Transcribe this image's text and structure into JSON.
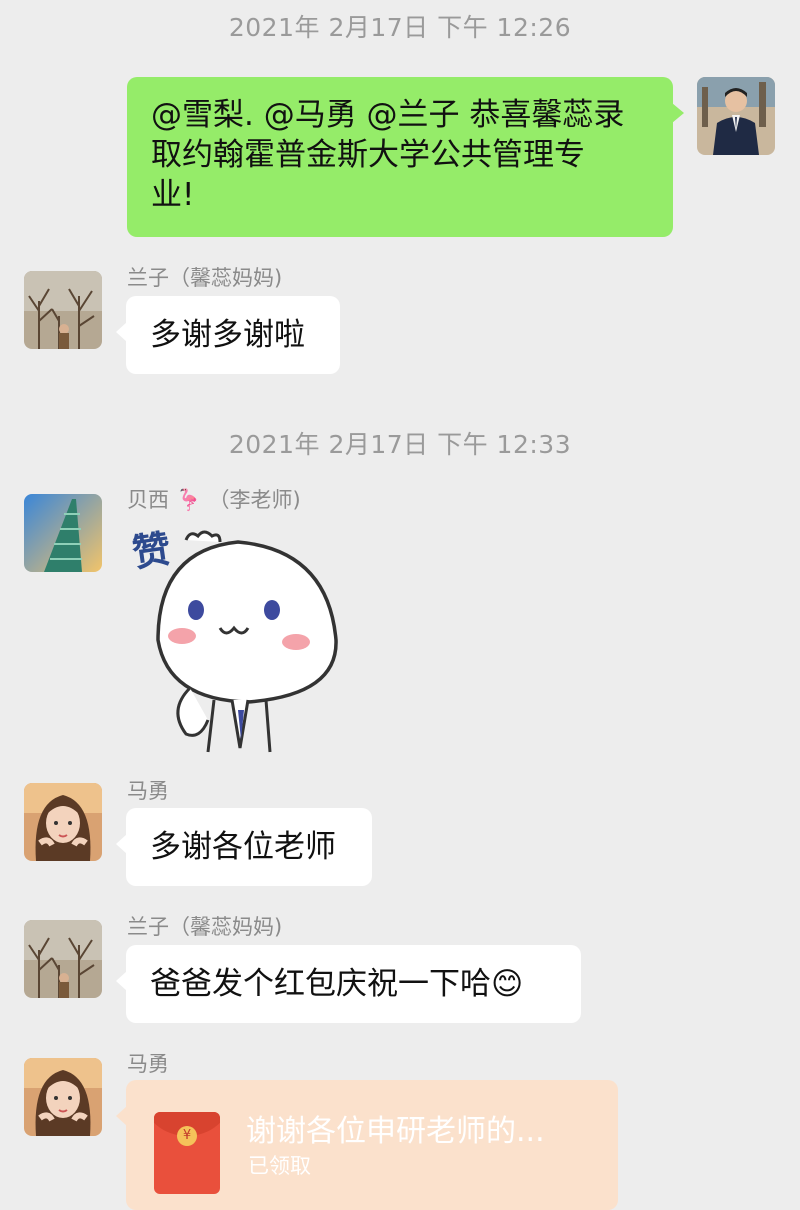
{
  "messages": [
    {
      "type": "timestamp",
      "text": "2021年 2月17日 下午 12:26"
    },
    {
      "type": "outgoing",
      "sender": "self",
      "text_line1": "@雪梨. @马勇 @兰子 恭喜馨蕊录",
      "text_line2": "取约翰霍普金斯大学公共管理专",
      "text_line3": "业!"
    },
    {
      "type": "incoming",
      "sender": "兰子（馨蕊妈妈)",
      "text": "多谢多谢啦"
    },
    {
      "type": "timestamp",
      "text": "2021年 2月17日 下午 12:33"
    },
    {
      "type": "sticker",
      "sender_name": "贝西",
      "sender_emoji": "🦩",
      "sender_note": "（李老师)",
      "sticker_text": "赞"
    },
    {
      "type": "incoming",
      "sender": "马勇",
      "text": "多谢各位老师"
    },
    {
      "type": "incoming",
      "sender": "兰子（馨蕊妈妈)",
      "text": "爸爸发个红包庆祝一下哈",
      "emoji": "😊"
    },
    {
      "type": "red_packet",
      "sender": "马勇",
      "title": "谢谢各位申研老师的...",
      "status": "已领取",
      "seal": "¥"
    }
  ],
  "colors": {
    "background": "#ededed",
    "outgoing_bubble": "#95ec69",
    "incoming_bubble": "#ffffff",
    "red_packet": "#fbe1cc",
    "red_packet_envelope": "#e9503c"
  },
  "icons": {
    "avatar_self": "man-in-suit-avatar",
    "avatar_lanzi": "bare-trees-avatar",
    "avatar_beixi": "tower-avatar",
    "avatar_mayong": "girl-portrait-avatar",
    "red_packet": "red-envelope-icon",
    "smile": "smile-emoji-icon"
  }
}
